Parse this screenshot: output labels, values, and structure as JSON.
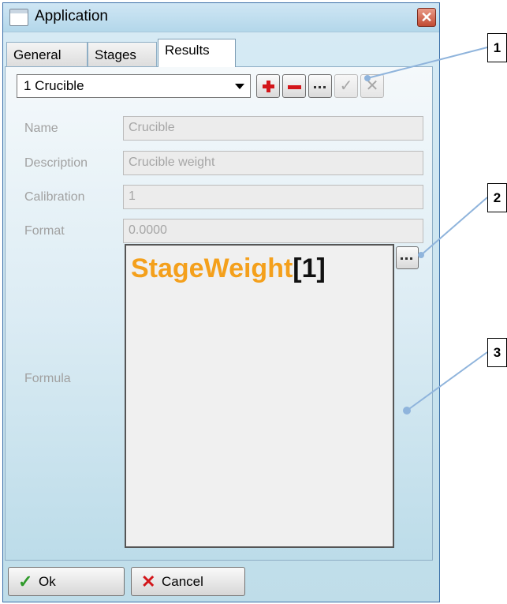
{
  "window": {
    "title": "Application"
  },
  "tabs": [
    {
      "label": "General"
    },
    {
      "label": "Stages"
    },
    {
      "label": "Results",
      "active": true
    }
  ],
  "toolbar": {
    "selected_result": "1 Crucible",
    "buttons": [
      {
        "name": "add",
        "icon": "plus-icon",
        "enabled": true
      },
      {
        "name": "remove",
        "icon": "minus-icon",
        "enabled": true
      },
      {
        "name": "more",
        "icon": "ellipsis-icon",
        "enabled": true
      },
      {
        "name": "apply",
        "icon": "check-icon",
        "enabled": false
      },
      {
        "name": "discard",
        "icon": "x-icon",
        "enabled": false
      }
    ]
  },
  "fields": {
    "name": {
      "label": "Name",
      "value": "Crucible"
    },
    "description": {
      "label": "Description",
      "value": "Crucible weight"
    },
    "calibration": {
      "label": "Calibration",
      "value": "1"
    },
    "format": {
      "label": "Format",
      "value": "0.0000"
    },
    "formula": {
      "label": "Formula",
      "function": "StageWeight",
      "argument": "[1]"
    }
  },
  "buttons": {
    "ok": "Ok",
    "cancel": "Cancel"
  },
  "callouts": [
    "1",
    "2",
    "3"
  ],
  "colors": {
    "formula_function": "#f4a01c",
    "formula_argument": "#111111",
    "accent_red": "#d3161a",
    "ok_green": "#2f9a2b",
    "callout_line": "#8fb4dc"
  }
}
